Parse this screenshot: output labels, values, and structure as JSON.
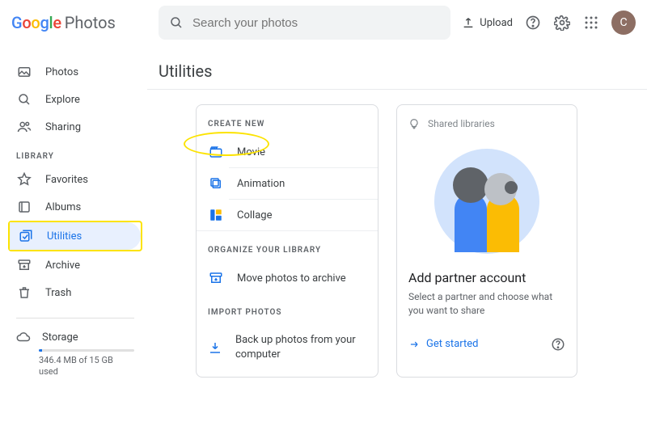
{
  "header": {
    "app_word": "Photos",
    "search_placeholder": "Search your photos",
    "upload_label": "Upload",
    "avatar_letter": "C"
  },
  "sidebar": {
    "items": [
      {
        "label": "Photos"
      },
      {
        "label": "Explore"
      },
      {
        "label": "Sharing"
      }
    ],
    "library_header": "LIBRARY",
    "library_items": [
      {
        "label": "Favorites"
      },
      {
        "label": "Albums"
      },
      {
        "label": "Utilities"
      },
      {
        "label": "Archive"
      },
      {
        "label": "Trash"
      }
    ],
    "storage": {
      "label": "Storage",
      "text": "346.4 MB of 15 GB used"
    }
  },
  "main": {
    "title": "Utilities",
    "left_card": {
      "create_header": "CREATE NEW",
      "create_items": [
        {
          "label": "Movie"
        },
        {
          "label": "Animation"
        },
        {
          "label": "Collage"
        }
      ],
      "organize_header": "ORGANIZE YOUR LIBRARY",
      "organize_item": "Move photos to archive",
      "import_header": "IMPORT PHOTOS",
      "import_item": "Back up photos from your computer"
    },
    "right_card": {
      "hint": "Shared libraries",
      "title": "Add partner account",
      "subtitle": "Select a partner and choose what you want to share",
      "cta": "Get started"
    }
  }
}
